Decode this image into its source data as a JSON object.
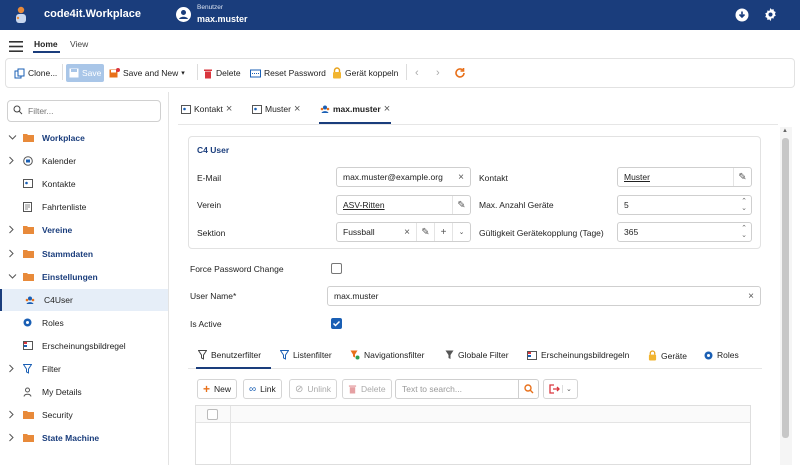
{
  "app": {
    "title": "code4it.Workplace",
    "user_caption": "Benutzer",
    "user_name": "max.muster"
  },
  "ribbon_tabs": [
    {
      "label": "Home",
      "active": true
    },
    {
      "label": "View",
      "active": false
    }
  ],
  "toolbar": {
    "clone": "Clone...",
    "save": "Save",
    "save_and_new": "Save and New",
    "delete": "Delete",
    "reset_password": "Reset Password",
    "geraet_koppeln": "Gerät koppeln"
  },
  "sidebar": {
    "filter_placeholder": "Filter...",
    "items": [
      {
        "label": "Workplace",
        "icon": "folder-icon",
        "group": true,
        "expanded": true
      },
      {
        "label": "Kalender",
        "icon": "calendar-icon"
      },
      {
        "label": "Kontakte",
        "icon": "contact-card-icon"
      },
      {
        "label": "Fahrtenliste",
        "icon": "document-icon"
      },
      {
        "label": "Vereine",
        "icon": "folder-icon",
        "group": true
      },
      {
        "label": "Stammdaten",
        "icon": "folder-icon",
        "group": true
      },
      {
        "label": "Einstellungen",
        "icon": "folder-icon",
        "group": true,
        "expanded": true
      },
      {
        "label": "C4User",
        "icon": "users-icon",
        "selected": true
      },
      {
        "label": "Roles",
        "icon": "role-icon"
      },
      {
        "label": "Erscheinungsbildregel",
        "icon": "grid-rule-icon"
      },
      {
        "label": "Filter",
        "icon": "filter-icon"
      },
      {
        "label": "My Details",
        "icon": "person-icon"
      },
      {
        "label": "Security",
        "icon": "folder-icon",
        "group": false
      },
      {
        "label": "State Machine",
        "icon": "folder-icon",
        "group": true
      }
    ]
  },
  "document_tabs": [
    {
      "label": "Kontakt",
      "icon": "contact-card-icon"
    },
    {
      "label": "Muster",
      "icon": "contact-card-icon"
    },
    {
      "label": "max.muster",
      "icon": "users-icon",
      "active": true
    }
  ],
  "form": {
    "card_title": "C4 User",
    "email_label": "E-Mail",
    "email_value": "max.muster@example.org",
    "kontakt_label": "Kontakt",
    "kontakt_value": "Muster",
    "verein_label": "Verein",
    "verein_value": "ASV-Ritten",
    "max_geraete_label": "Max. Anzahl Geräte",
    "max_geraete_value": "5",
    "sektion_label": "Sektion",
    "sektion_value": "Fussball",
    "gueltigkeit_label": "Gültigkeit Gerätekopplung (Tage)",
    "gueltigkeit_value": "365",
    "force_pw_label": "Force Password Change",
    "force_pw_checked": false,
    "username_label": "User Name*",
    "username_value": "max.muster",
    "active_label": "Is Active",
    "active_checked": true
  },
  "subtabs": [
    {
      "label": "Benutzerfilter",
      "icon": "filter-icon",
      "active": true
    },
    {
      "label": "Listenfilter",
      "icon": "filter-icon"
    },
    {
      "label": "Navigationsfilter",
      "icon": "nav-filter-icon"
    },
    {
      "label": "Globale Filter",
      "icon": "filter-solid-icon"
    },
    {
      "label": "Erscheinungsbildregeln",
      "icon": "grid-rule-icon"
    },
    {
      "label": "Geräte",
      "icon": "lock-icon"
    },
    {
      "label": "Roles",
      "icon": "role-icon"
    }
  ],
  "grid_toolbar": {
    "new": "New",
    "link": "Link",
    "unlink": "Unlink",
    "delete": "Delete",
    "search_placeholder": "Text to search..."
  },
  "colors": {
    "brand": "#1a3d7c",
    "folder": "#e88a3a",
    "accent_orange": "#e8701a",
    "delete_red": "#d9363e",
    "link_blue": "#1a5fb4"
  }
}
